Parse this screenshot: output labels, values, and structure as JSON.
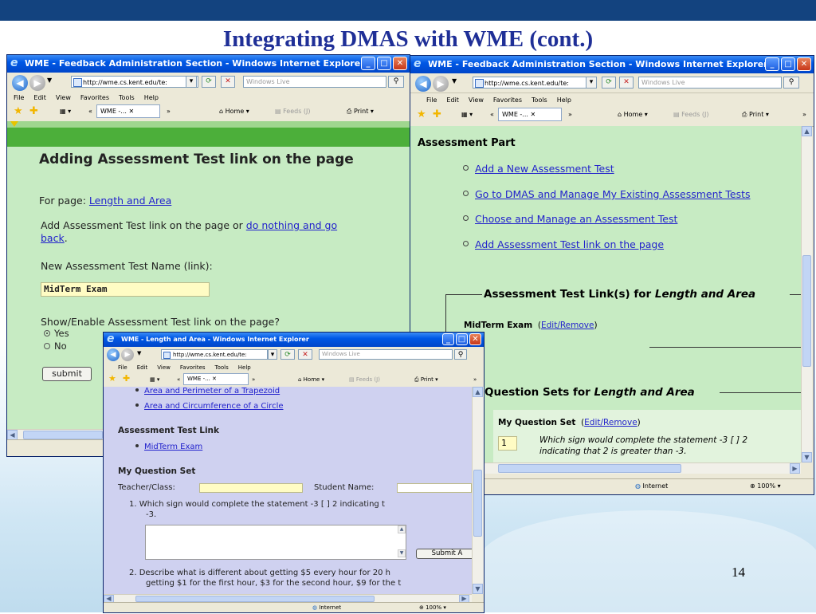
{
  "slide": {
    "title": "Integrating DMAS with WME  (cont.)",
    "page_number": "14"
  },
  "browser_common": {
    "address": "http://wme.cs.kent.edu/te:",
    "search_placeholder": "Windows Live",
    "menu": [
      "File",
      "Edit",
      "View",
      "Favorites",
      "Tools",
      "Help"
    ],
    "tab_label": "WME -...",
    "home": "Home",
    "feeds": "Feeds (J)",
    "print": "Print",
    "status_zone": "Internet",
    "zoom": "100%"
  },
  "window_left": {
    "title": "WME - Feedback Administration Section - Windows Internet Explorer",
    "heading": "Adding Assessment Test link on the page",
    "for_page_prefix": "For page: ",
    "for_page_link": "Length and Area",
    "instruction_text": "Add Assessment Test link on the page or ",
    "instruction_link_1": "do nothing and go",
    "instruction_link_2": "back",
    "instruction_end": ".",
    "name_label": "New Assessment Test Name (link):",
    "name_value": "MidTerm Exam",
    "show_label": "Show/Enable Assessment Test link on the page?",
    "option_yes": "Yes",
    "option_no": "No",
    "submit_label": "submit"
  },
  "window_right": {
    "title": "WME - Feedback Administration Section - Windows Internet Explorer",
    "section_heading": "Assessment Part",
    "links": [
      "Add a New Assessment Test",
      "Go to DMAS and Manage My Existing Assessment Tests",
      "Choose and Manage an Assessment Test",
      "Add Assessment Test link on the page"
    ],
    "links_legend_prefix": "Assessment Test Link(s) for ",
    "links_legend_italic": "Length and Area",
    "midterm_label": "MidTerm Exam",
    "edit_remove": "Edit/Remove",
    "qsets_legend_prefix": "Question Sets for ",
    "qsets_legend_italic": "Length and Area",
    "my_question_set": "My Question Set",
    "q1_number": "1",
    "q1_text_line1": "Which sign would complete the statement -3 [ ] 2",
    "q1_text_line2": "indicating that 2 is greater than -3."
  },
  "window_front": {
    "title": "WME - Length and Area - Windows Internet Explorer",
    "links": [
      "Area and Perimeter of a Trapezoid",
      "Area and Circumference of a Circle"
    ],
    "assessment_heading": "Assessment Test Link",
    "assessment_link": "MidTerm Exam",
    "question_set_heading": "My Question Set",
    "teacher_label": "Teacher/Class:",
    "student_label": "Student Name:",
    "q1_line1": "1.  Which sign would complete the statement -3 [ ] 2 indicating t",
    "q1_line2": "-3.",
    "submit_answer": "Submit A",
    "q2_line1": "2.  Describe what is different about getting $5 every hour for 20 h",
    "q2_line2": "getting $1 for the first hour, $3 for the second hour, $9 for the t"
  }
}
